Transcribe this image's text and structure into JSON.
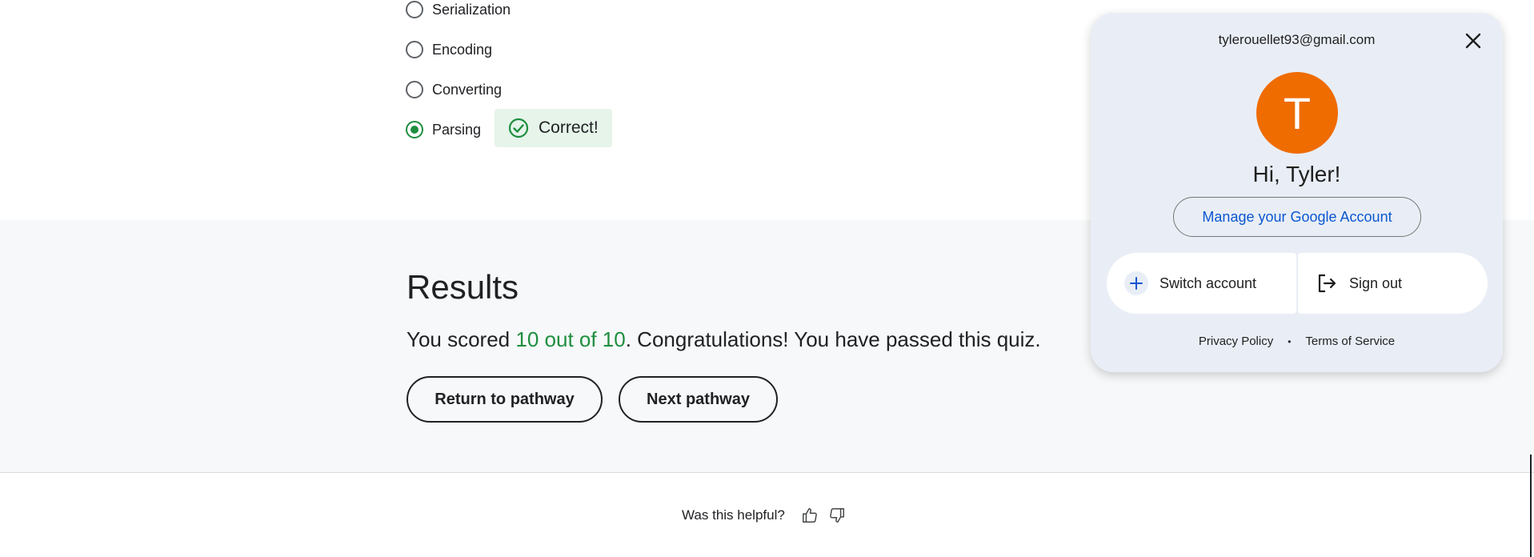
{
  "quiz": {
    "options": [
      {
        "label": "Serialization",
        "selected": false
      },
      {
        "label": "Encoding",
        "selected": false
      },
      {
        "label": "Converting",
        "selected": false
      },
      {
        "label": "Parsing",
        "selected": true
      }
    ],
    "feedback_label": "Correct!",
    "feedback_icon": "check-circle-icon",
    "accent_color": "#1e8e3e"
  },
  "results": {
    "title": "Results",
    "score_prefix": "You scored ",
    "score_value": "10 out of 10",
    "score_suffix": ". Congratulations! You have passed this quiz.",
    "return_button": "Return to pathway",
    "next_button": "Next pathway"
  },
  "feedback": {
    "question": "Was this helpful?",
    "thumbs_up_icon": "thumbs-up-icon",
    "thumbs_down_icon": "thumbs-down-icon"
  },
  "account_panel": {
    "email": "tylerouellet93@gmail.com",
    "avatar_letter": "T",
    "avatar_color": "#ef6c00",
    "greeting": "Hi, Tyler!",
    "manage_button": "Manage your Google Account",
    "switch_account": "Switch account",
    "sign_out": "Sign out",
    "privacy_policy": "Privacy Policy",
    "separator": "•",
    "terms": "Terms of Service"
  }
}
